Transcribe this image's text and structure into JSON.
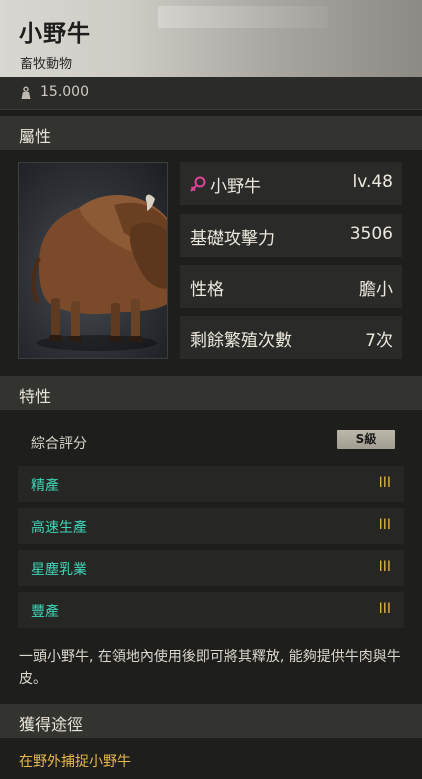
{
  "header": {
    "title": "小野牛",
    "subtitle": "畜牧動物"
  },
  "weight": {
    "icon": "weight-icon",
    "value": "15.000"
  },
  "attributes": {
    "heading": "屬性",
    "name": "小野牛",
    "gender_icon": "female-icon",
    "level": "lv.48",
    "stats": [
      {
        "label": "基礎攻擊力",
        "value": "3506"
      },
      {
        "label": "性格",
        "value": "膽小"
      },
      {
        "label": "剩餘繁殖次數",
        "value": "7次"
      }
    ]
  },
  "traits": {
    "heading": "特性",
    "score_label": "綜合評分",
    "score_badge": "S級",
    "items": [
      {
        "label": "精產",
        "rank": "III"
      },
      {
        "label": "高速生產",
        "rank": "III"
      },
      {
        "label": "星塵乳業",
        "rank": "III"
      },
      {
        "label": "豐產",
        "rank": "III"
      }
    ]
  },
  "description": "一頭小野牛, 在領地內使用後即可將其釋放, 能夠提供牛肉與牛皮。",
  "acquire": {
    "heading": "獲得途徑",
    "source": "在野外捕捉小野牛"
  },
  "colors": {
    "trait_text": "#3fd6b6",
    "rank_text": "#e2b33c",
    "source_text": "#e6b84a"
  }
}
